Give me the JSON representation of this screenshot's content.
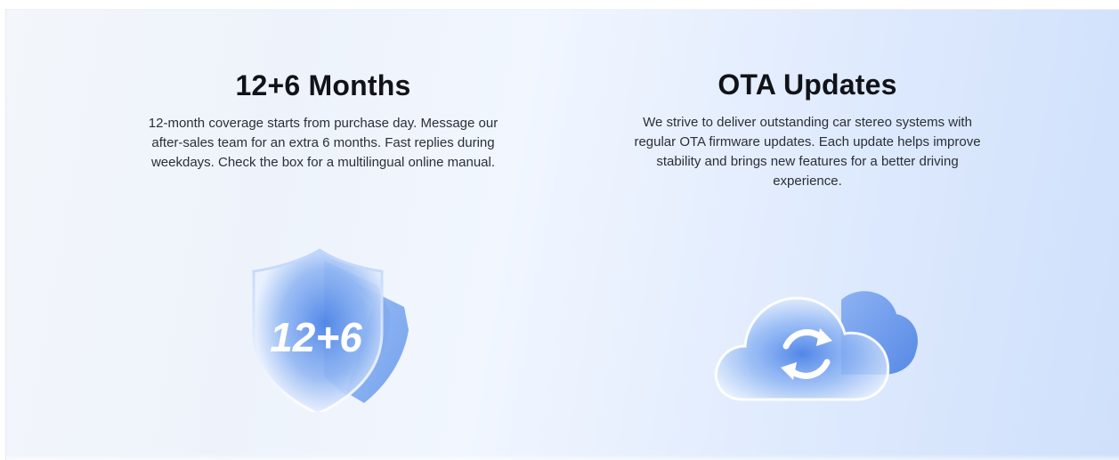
{
  "features": [
    {
      "title": "12+6 Months",
      "description": "12-month coverage starts from purchase day. Message our after-sales team for an extra 6 months. Fast replies during weekdays. Check the box for a multilingual online manual.",
      "icon": "shield-icon",
      "icon_text": "12+6"
    },
    {
      "title": "OTA Updates",
      "description": "We strive to deliver outstanding car stereo systems with regular OTA firmware updates. Each update helps improve stability and brings new features for a better driving experience.",
      "icon": "cloud-sync-icon"
    }
  ],
  "colors": {
    "accent_blue": "#4f86e8",
    "light_blue": "#a9c8f6",
    "title_text": "#111318",
    "body_text": "#2b2f36"
  }
}
